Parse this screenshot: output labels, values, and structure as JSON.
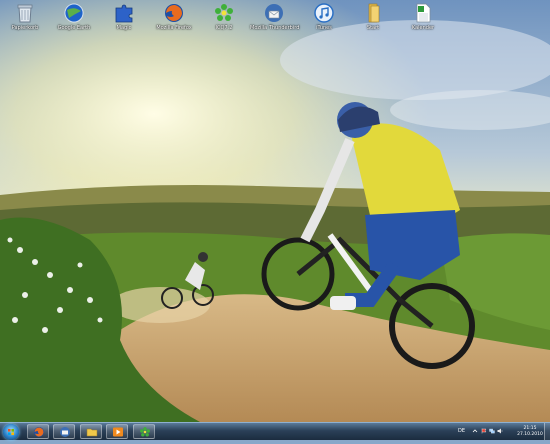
{
  "desktop": {
    "icons": [
      {
        "label": "Papierkorb",
        "icon": "recycle-bin-icon"
      },
      {
        "label": "Google Earth",
        "icon": "google-earth-icon"
      },
      {
        "label": "Magic",
        "icon": "magic-puzzle-icon"
      },
      {
        "label": "Mozilla Firefox",
        "icon": "firefox-icon"
      },
      {
        "label": "ICQ7.2",
        "icon": "icq-flower-icon"
      },
      {
        "label": "Mozilla Thunderbird",
        "icon": "thunderbird-icon"
      },
      {
        "label": "iTunes",
        "icon": "itunes-icon"
      },
      {
        "label": "Start",
        "icon": "folder-icon"
      },
      {
        "label": "Kalender",
        "icon": "calendar-sheet-icon"
      }
    ],
    "wallpaper": "mountain-bike-riders-on-dirt-trail"
  },
  "taskbar": {
    "start_icon": "windows-start-orb-icon",
    "pinned": [
      {
        "icon": "firefox-icon"
      },
      {
        "icon": "thunderbird-icon"
      },
      {
        "icon": "explorer-folder-icon"
      },
      {
        "icon": "media-player-icon"
      },
      {
        "icon": "icq-flower-icon"
      }
    ],
    "tray": {
      "language": "DE",
      "time": "21:15",
      "date": "27.10.2010"
    }
  },
  "colors": {
    "taskbar": "#1b2c3f",
    "sky": "#87a7c9",
    "trail": "#c9a36a"
  }
}
